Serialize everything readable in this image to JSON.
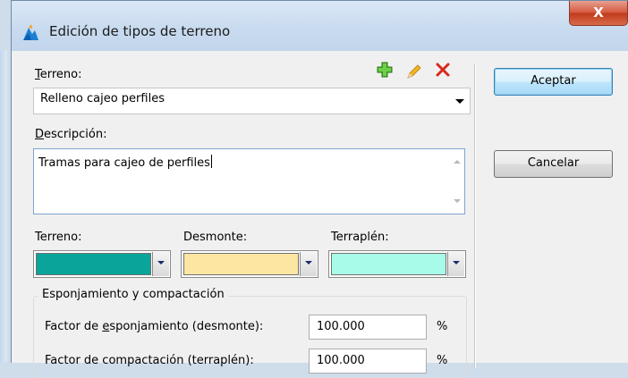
{
  "window": {
    "title": "Edición de tipos de terreno",
    "close_label": "X"
  },
  "terreno": {
    "label_hotkey": "T",
    "label_rest": "erreno:",
    "selected": "Relleno cajeo perfiles"
  },
  "descripcion": {
    "label_hotkey": "D",
    "label_rest": "escripción:",
    "value": "Tramas para cajeo de perfiles"
  },
  "colors": {
    "terreno_label": "Terreno:",
    "terreno_color": "#0aa59a",
    "desmonte_label": "Desmonte:",
    "desmonte_color": "#fde6a2",
    "terraplen_label": "Terraplén:",
    "terraplen_color": "#a9fbe9"
  },
  "group": {
    "title": "Esponjamiento y compactación",
    "row1_pre": "Factor de ",
    "row1_hotkey": "e",
    "row1_post": "sponjamiento (desmonte):",
    "row1_value": "100.000",
    "row1_unit": "%",
    "row2_label": "Factor de compactación (terraplén):",
    "row2_value": "100.000",
    "row2_unit": "%"
  },
  "buttons": {
    "accept": "Aceptar",
    "cancel": "Cancelar"
  },
  "icons": [
    "app-icon",
    "add-icon",
    "edit-icon",
    "delete-icon"
  ]
}
